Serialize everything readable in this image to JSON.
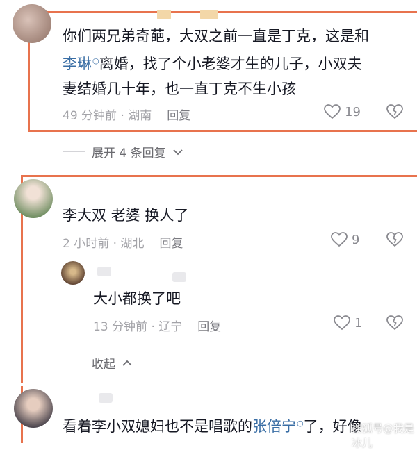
{
  "comments": [
    {
      "text_before_mention": "你们两兄弟奇葩，大双之前一直是丁克，这是和",
      "mention": "李琳",
      "text_after_mention_line2": "离婚，找了个小老婆才生的儿子，小双夫",
      "text_line3": "妻结婚几十年，也一直丁克不生小孩",
      "meta": "49 分钟前 · 湖南",
      "reply_label": "回复",
      "likes": "19"
    },
    {
      "text": "李大双  老婆  换人了",
      "meta": "2 小时前 · 湖北",
      "reply_label": "回复",
      "likes": "9"
    },
    {
      "text": "大小都换了吧",
      "meta": "13 分钟前 · 辽宁",
      "reply_label": "回复",
      "likes": "1"
    },
    {
      "text_before_mention": "看着李小双媳妇也不是唱歌的",
      "mention": "张倍宁",
      "text_after_mention": "了，好像"
    }
  ],
  "expand_replies": "展开 4 条回复",
  "collapse_label": "收起",
  "watermark": "搜狐号@我是冰儿",
  "colors": {
    "frame": "#e8734e",
    "mention": "#3a6ea5"
  }
}
